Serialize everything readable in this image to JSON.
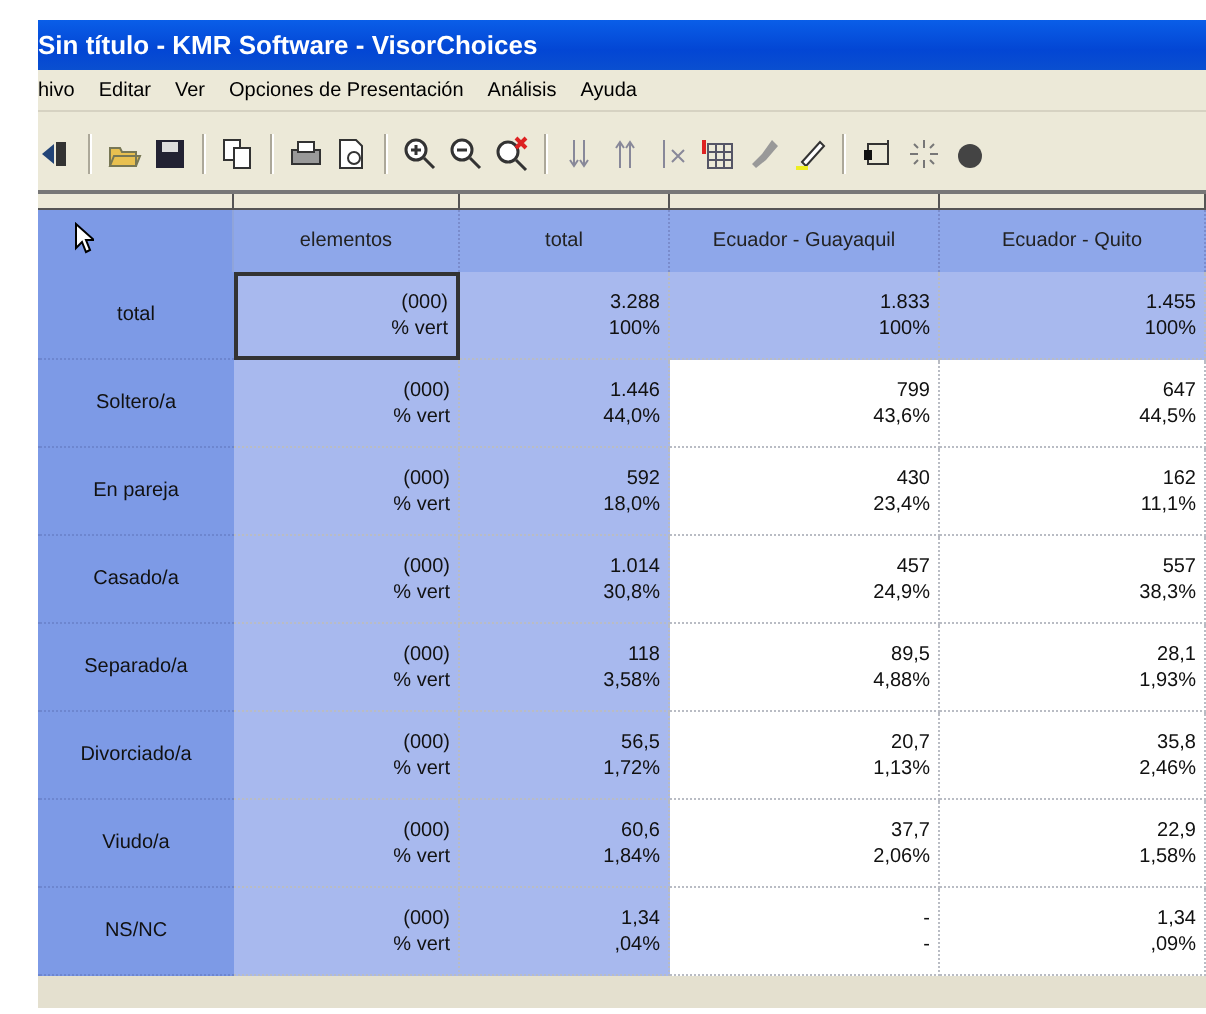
{
  "window": {
    "title": "Sin título - KMR Software - VisorChoices"
  },
  "menu": [
    "hivo",
    "Editar",
    "Ver",
    "Opciones de Presentación",
    "Análisis",
    "Ayuda"
  ],
  "table": {
    "columns": [
      {
        "label": "elementos",
        "kind": "label"
      },
      {
        "label": "total",
        "kind": "total"
      },
      {
        "label": "Ecuador - Guayaquil",
        "kind": "data"
      },
      {
        "label": "Ecuador - Quito",
        "kind": "data"
      }
    ],
    "rows": [
      {
        "label": "total",
        "kind": "total",
        "cells": [
          {
            "lines": [
              "(000)",
              "% vert"
            ],
            "selected": true
          },
          {
            "lines": [
              "3.288",
              "100%"
            ],
            "selected": false
          },
          {
            "lines": [
              "1.833",
              "100%"
            ],
            "selected": false
          },
          {
            "lines": [
              "1.455",
              "100%"
            ],
            "selected": false
          }
        ]
      },
      {
        "label": "Soltero/a",
        "kind": "category",
        "cells": [
          {
            "lines": [
              "(000)",
              "% vert"
            ],
            "selected": false
          },
          {
            "lines": [
              "1.446",
              "44,0%"
            ],
            "selected": false
          },
          {
            "lines": [
              "799",
              "43,6%"
            ],
            "selected": false
          },
          {
            "lines": [
              "647",
              "44,5%"
            ],
            "selected": false
          }
        ]
      },
      {
        "label": "En pareja",
        "kind": "category",
        "cells": [
          {
            "lines": [
              "(000)",
              "% vert"
            ],
            "selected": false
          },
          {
            "lines": [
              "592",
              "18,0%"
            ],
            "selected": false
          },
          {
            "lines": [
              "430",
              "23,4%"
            ],
            "selected": false
          },
          {
            "lines": [
              "162",
              "11,1%"
            ],
            "selected": false
          }
        ]
      },
      {
        "label": "Casado/a",
        "kind": "category",
        "cells": [
          {
            "lines": [
              "(000)",
              "% vert"
            ],
            "selected": false
          },
          {
            "lines": [
              "1.014",
              "30,8%"
            ],
            "selected": false
          },
          {
            "lines": [
              "457",
              "24,9%"
            ],
            "selected": false
          },
          {
            "lines": [
              "557",
              "38,3%"
            ],
            "selected": false
          }
        ]
      },
      {
        "label": "Separado/a",
        "kind": "category",
        "cells": [
          {
            "lines": [
              "(000)",
              "% vert"
            ],
            "selected": false
          },
          {
            "lines": [
              "118",
              "3,58%"
            ],
            "selected": false
          },
          {
            "lines": [
              "89,5",
              "4,88%"
            ],
            "selected": false
          },
          {
            "lines": [
              "28,1",
              "1,93%"
            ],
            "selected": false
          }
        ]
      },
      {
        "label": "Divorciado/a",
        "kind": "category",
        "cells": [
          {
            "lines": [
              "(000)",
              "% vert"
            ],
            "selected": false
          },
          {
            "lines": [
              "56,5",
              "1,72%"
            ],
            "selected": false
          },
          {
            "lines": [
              "20,7",
              "1,13%"
            ],
            "selected": false
          },
          {
            "lines": [
              "35,8",
              "2,46%"
            ],
            "selected": false
          }
        ]
      },
      {
        "label": "Viudo/a",
        "kind": "category",
        "cells": [
          {
            "lines": [
              "(000)",
              "% vert"
            ],
            "selected": false
          },
          {
            "lines": [
              "60,6",
              "1,84%"
            ],
            "selected": false
          },
          {
            "lines": [
              "37,7",
              "2,06%"
            ],
            "selected": false
          },
          {
            "lines": [
              "22,9",
              "1,58%"
            ],
            "selected": false
          }
        ]
      },
      {
        "label": "NS/NC",
        "kind": "category",
        "cells": [
          {
            "lines": [
              "(000)",
              "% vert"
            ],
            "selected": false
          },
          {
            "lines": [
              "1,34",
              ",04%"
            ],
            "selected": false
          },
          {
            "lines": [
              "-",
              "-"
            ],
            "selected": false
          },
          {
            "lines": [
              "1,34",
              ",09%"
            ],
            "selected": false
          }
        ]
      }
    ]
  }
}
